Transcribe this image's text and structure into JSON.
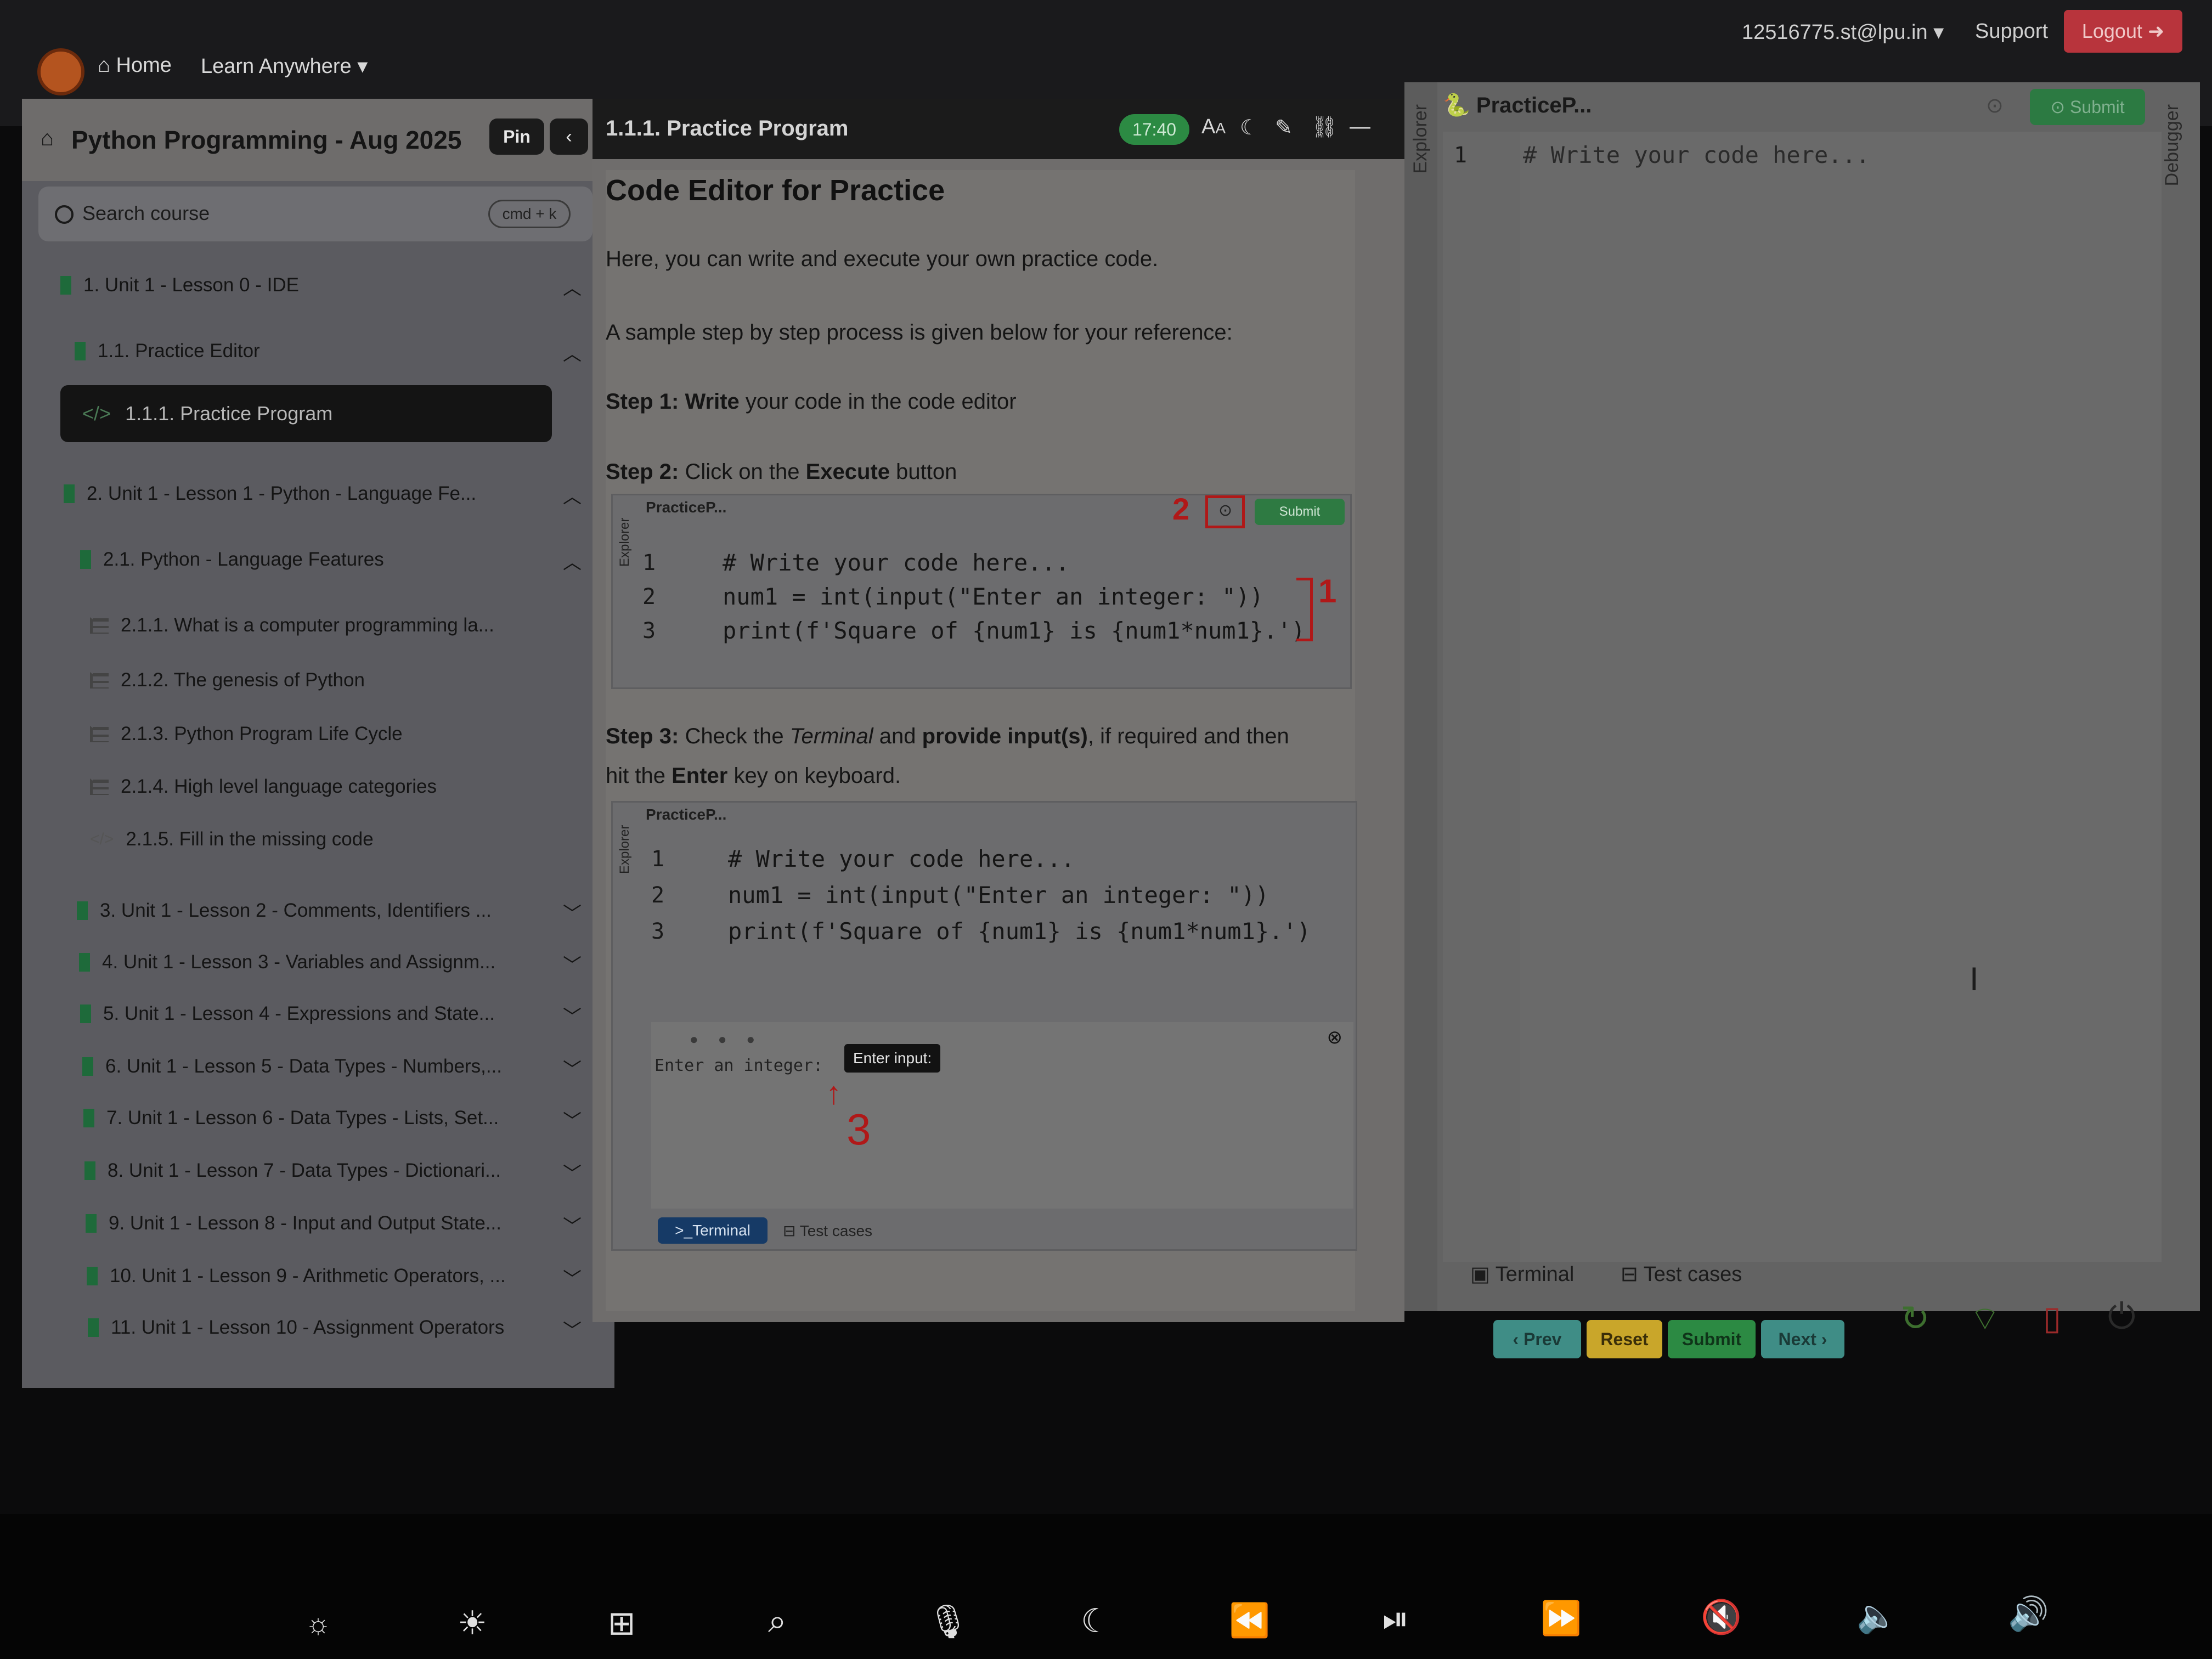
{
  "topnav": {
    "home": "Home",
    "learn_anywhere": "Learn Anywhere",
    "user": "12516775.st@lpu.in",
    "support": "Support",
    "logout": "Logout"
  },
  "sidebar": {
    "course_title": "Python Programming - Aug 2025",
    "pin": "Pin",
    "search_placeholder": "Search course",
    "shortcut": "cmd + k",
    "items": [
      {
        "label": "1. Unit 1 - Lesson 0 - IDE"
      },
      {
        "label": "1.1. Practice Editor"
      },
      {
        "label": "1.1.1. Practice Program"
      },
      {
        "label": "2. Unit 1 - Lesson 1 - Python - Language Fe..."
      },
      {
        "label": "2.1. Python - Language Features"
      },
      {
        "label": "2.1.1. What is a computer programming la..."
      },
      {
        "label": "2.1.2. The genesis of Python"
      },
      {
        "label": "2.1.3. Python Program Life Cycle"
      },
      {
        "label": "2.1.4. High level language categories"
      },
      {
        "label": "2.1.5. Fill in the missing code"
      },
      {
        "label": "3. Unit 1 - Lesson 2 - Comments, Identifiers ..."
      },
      {
        "label": "4. Unit 1 - Lesson 3 - Variables and Assignm..."
      },
      {
        "label": "5. Unit 1 - Lesson 4 - Expressions and State..."
      },
      {
        "label": "6. Unit 1 - Lesson 5 - Data Types - Numbers,..."
      },
      {
        "label": "7. Unit 1 - Lesson 6 - Data Types - Lists, Set..."
      },
      {
        "label": "8. Unit 1 - Lesson 7 - Data Types - Dictionari..."
      },
      {
        "label": "9. Unit 1 - Lesson 8 - Input and Output State..."
      },
      {
        "label": "10. Unit 1 - Lesson 9 - Arithmetic Operators, ..."
      },
      {
        "label": "11. Unit 1 - Lesson 10 - Assignment Operators"
      }
    ]
  },
  "middle": {
    "title": "1.1.1. Practice Program",
    "timer": "17:40",
    "heading": "Code Editor for Practice",
    "intro": "Here, you can write and execute your own practice code.",
    "sample": "A sample step by step process is given below for your reference:",
    "step1_prefix": "Step 1:",
    "step1_bold": "Write",
    "step1_rest": "your code in the code editor",
    "step2_prefix": "Step 2:",
    "step2_text": "Click on the",
    "step2_bold": "Execute",
    "step2_rest": "button",
    "step3_prefix": "Step 3:",
    "step3_a": "Check the",
    "step3_terminal": "Terminal",
    "step3_b": "and",
    "step3_bold": "provide input(s)",
    "step3_c": ", if required and then",
    "step3_line2_a": "hit the",
    "step3_enter": "Enter",
    "step3_line2_b": "key on keyboard.",
    "code_tab": "PracticeP...",
    "explorer": "Explorer",
    "code_lines": [
      "# Write your code here...",
      "num1 = int(input(\"Enter an integer: \"))",
      "print(f'Square of {num1} is {num1*num1}.')"
    ],
    "line_numbers": [
      "1",
      "2",
      "3"
    ],
    "mini_submit": "Submit",
    "annotation_1": "1",
    "annotation_2": "2",
    "annotation_3": "3",
    "terminal_prompt": "Enter an integer:",
    "tooltip": "Enter input:",
    "terminal_tab": "Terminal",
    "testcases_tab": "Test cases"
  },
  "editor": {
    "explorer": "Explorer",
    "debugger": "Debugger",
    "tab": "PracticeP...",
    "line_number": "1",
    "code": "# Write your code here...",
    "submit": "Submit",
    "terminal": "Terminal",
    "testcases": "Test cases"
  },
  "actions": {
    "prev": "‹ Prev",
    "reset": "Reset",
    "submit": "Submit",
    "next": "Next ›"
  },
  "colors": {
    "accent_green": "#2c8a43",
    "logout_red": "#b8343c",
    "reset_yellow": "#c9a62a",
    "nav_teal": "#3f8d86"
  }
}
